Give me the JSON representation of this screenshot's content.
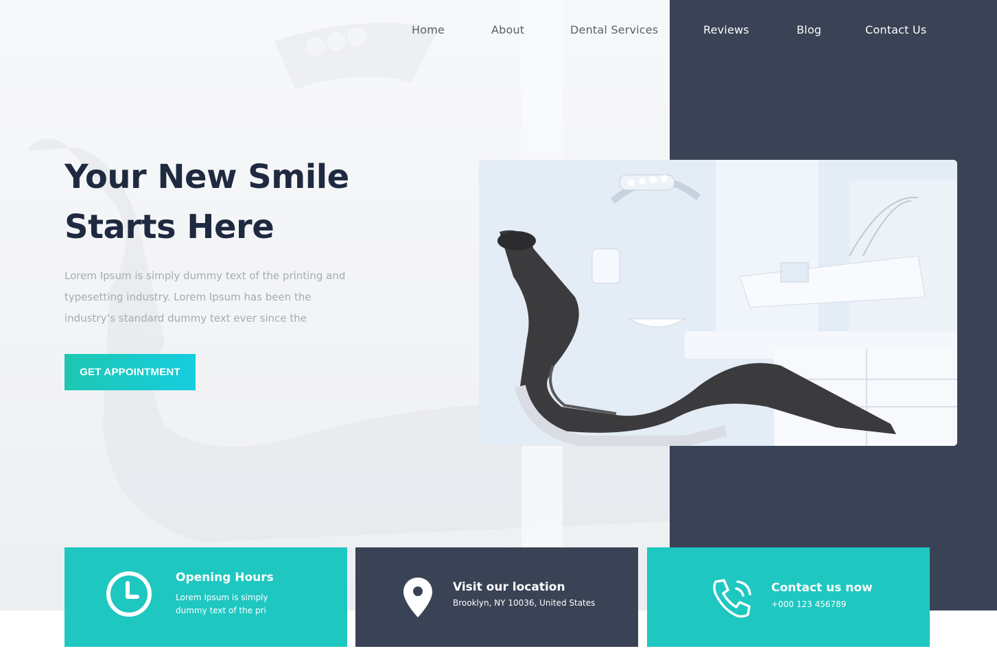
{
  "nav": {
    "items": [
      "Home",
      "About",
      "Dental Services",
      "Reviews",
      "Blog",
      "Contact Us"
    ]
  },
  "hero": {
    "title_line1": "Your New Smile",
    "title_line2": "Starts Here",
    "text": "Lorem Ipsum is simply dummy text of the printing and typesetting industry. Lorem Ipsum has been the industry’s standard dummy text ever since the",
    "cta_label": "GET APPOINTMENT"
  },
  "cards": [
    {
      "title": "Opening Hours",
      "text": "Lorem Ipsum is simply dummy text of the pri",
      "icon": "clock-icon"
    },
    {
      "title": "Visit our location",
      "text": "Brooklyn, NY 10036, United States",
      "icon": "location-pin-icon"
    },
    {
      "title": "Contact us now",
      "text": "+000 123 456789",
      "icon": "phone-icon"
    }
  ],
  "colors": {
    "navy": "#3a4255",
    "teal": "#1fc7c1",
    "heading": "#1f2a40",
    "muted_text": "#a6aab2"
  }
}
